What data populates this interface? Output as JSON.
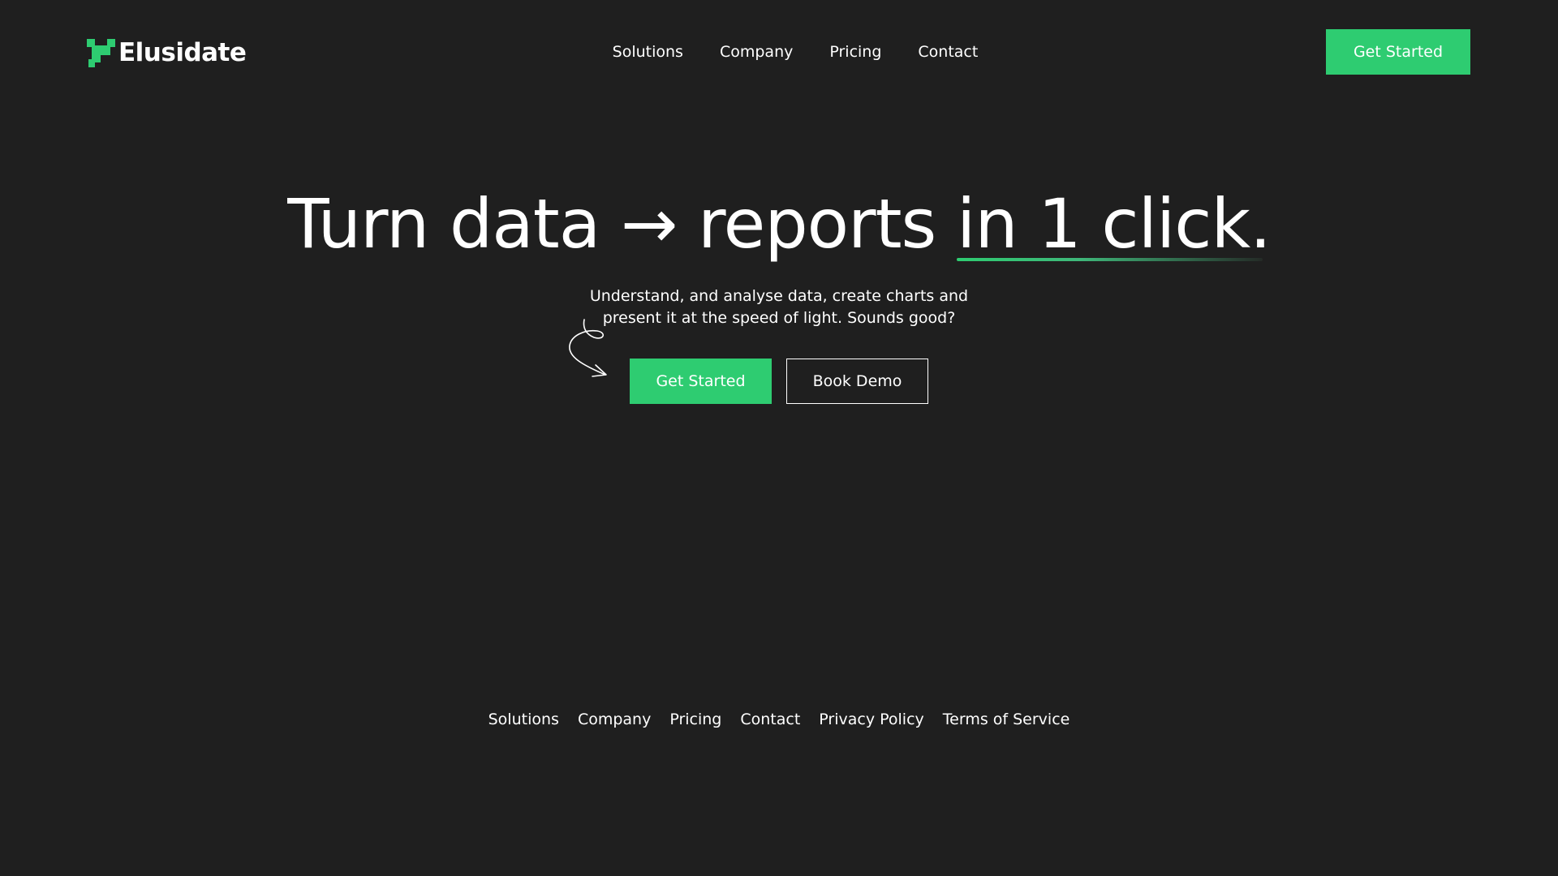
{
  "brand": {
    "name": "Elusidate",
    "accent_color": "#2ecc71",
    "background_color": "#1f1f1f"
  },
  "header": {
    "nav": [
      "Solutions",
      "Company",
      "Pricing",
      "Contact"
    ],
    "cta_label": "Get Started"
  },
  "hero": {
    "title_part1": "Turn data → reports ",
    "title_accent": "in 1 click.",
    "subtitle_line1": "Understand, and analyse data, create charts and",
    "subtitle_line2": "present it at the speed of light. Sounds good?",
    "primary_label": "Get Started",
    "secondary_label": "Book Demo",
    "arrow_icon": "squiggle-arrow-icon"
  },
  "footer": {
    "links": [
      "Solutions",
      "Company",
      "Pricing",
      "Contact",
      "Privacy Policy",
      "Terms of Service"
    ]
  }
}
